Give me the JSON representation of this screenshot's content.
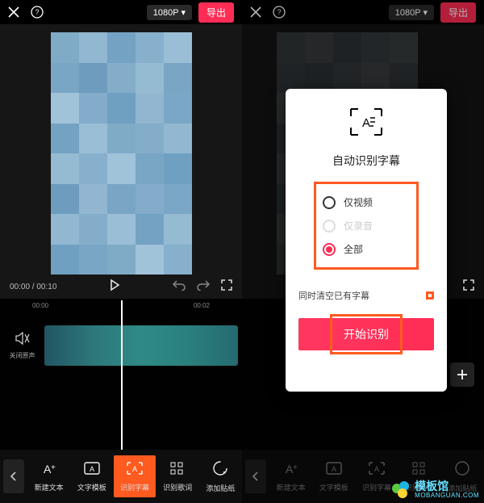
{
  "header": {
    "resolution": "1080P",
    "export_label": "导出"
  },
  "transport": {
    "time_current": "00:00",
    "time_total": "00:10"
  },
  "timeline": {
    "ticks": [
      "00:00",
      "00:02"
    ],
    "mute_label": "关闭原声"
  },
  "tools": {
    "back": "‹",
    "items": [
      {
        "label": "新建文本"
      },
      {
        "label": "文字模板"
      },
      {
        "label": "识别字幕"
      },
      {
        "label": "识别歌词"
      },
      {
        "label": "添加贴纸"
      }
    ]
  },
  "modal": {
    "title": "自动识别字幕",
    "options": [
      {
        "label": "仅视频",
        "selected": false,
        "enabled": true
      },
      {
        "label": "仅录音",
        "selected": false,
        "enabled": false
      },
      {
        "label": "全部",
        "selected": true,
        "enabled": true
      }
    ],
    "clear_label": "同时清空已有字幕",
    "start_label": "开始识别"
  },
  "watermark": {
    "title": "模板馆",
    "sub": "MOBANGUAN.COM"
  }
}
